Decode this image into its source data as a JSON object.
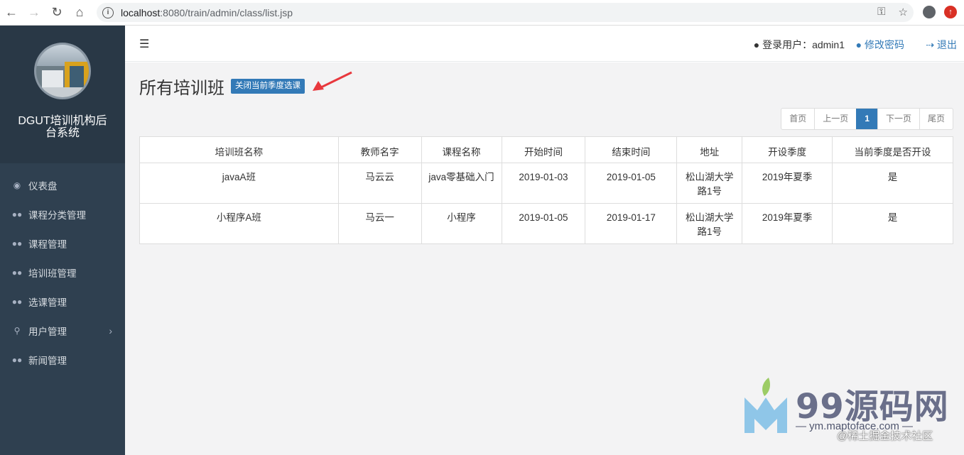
{
  "browser": {
    "url_host": "localhost",
    "url_path": ":8080/train/admin/class/list.jsp",
    "icons": [
      "back-icon",
      "forward-icon",
      "reload-icon",
      "home-icon",
      "info-icon",
      "key-icon",
      "star-icon",
      "account-icon",
      "update-icon"
    ]
  },
  "sidebar": {
    "site_title": "DGUT培训机构后台系统",
    "items": [
      {
        "label": "仪表盘",
        "icon": "dashboard-icon"
      },
      {
        "label": "课程分类管理",
        "icon": "users-icon"
      },
      {
        "label": "课程管理",
        "icon": "users-icon"
      },
      {
        "label": "培训班管理",
        "icon": "users-icon"
      },
      {
        "label": "选课管理",
        "icon": "users-icon"
      },
      {
        "label": "用户管理",
        "icon": "pin-icon"
      },
      {
        "label": "新闻管理",
        "icon": "users-icon"
      }
    ]
  },
  "topbar": {
    "user_label": "登录用户：admin1",
    "change_password": "修改密码",
    "logout": "退出"
  },
  "page": {
    "title": "所有培训班",
    "close_button": "关闭当前季度选课"
  },
  "pager": {
    "first": "首页",
    "prev": "上一页",
    "current": "1",
    "next": "下一页",
    "last": "尾页"
  },
  "table": {
    "headers": [
      "培训班名称",
      "教师名字",
      "课程名称",
      "开始时间",
      "结束时间",
      "地址",
      "开设季度",
      "当前季度是否开设"
    ],
    "rows": [
      [
        "javaA班",
        "马云云",
        "java零基础入门",
        "2019-01-03",
        "2019-01-05",
        "松山湖大学路1号",
        "2019年夏季",
        "是"
      ],
      [
        "小程序A班",
        "马云一",
        "小程序",
        "2019-01-05",
        "2019-01-17",
        "松山湖大学路1号",
        "2019年夏季",
        "是"
      ]
    ]
  },
  "watermark": {
    "brand": "99源码网",
    "url": "— ym.maptoface.com —",
    "credit": "@稀土掘金技术社区"
  },
  "colors": {
    "sidebar_bg": "#2f4050",
    "accent": "#337ab7",
    "arrow": "#e8383d"
  }
}
